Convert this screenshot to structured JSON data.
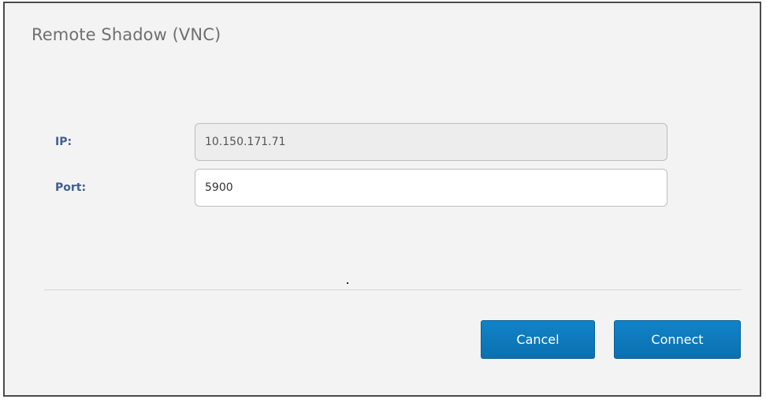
{
  "dialog": {
    "title": "Remote Shadow (VNC)",
    "fields": {
      "ip": {
        "label": "IP:",
        "value": "10.150.171.71",
        "readonly": true
      },
      "port": {
        "label": "Port:",
        "value": "5900"
      }
    },
    "buttons": {
      "cancel_label": "Cancel",
      "connect_label": "Connect"
    }
  },
  "colors": {
    "label": "#3f5f8f",
    "button_bg": "#0b70b0",
    "dialog_bg": "#f3f3f3"
  }
}
